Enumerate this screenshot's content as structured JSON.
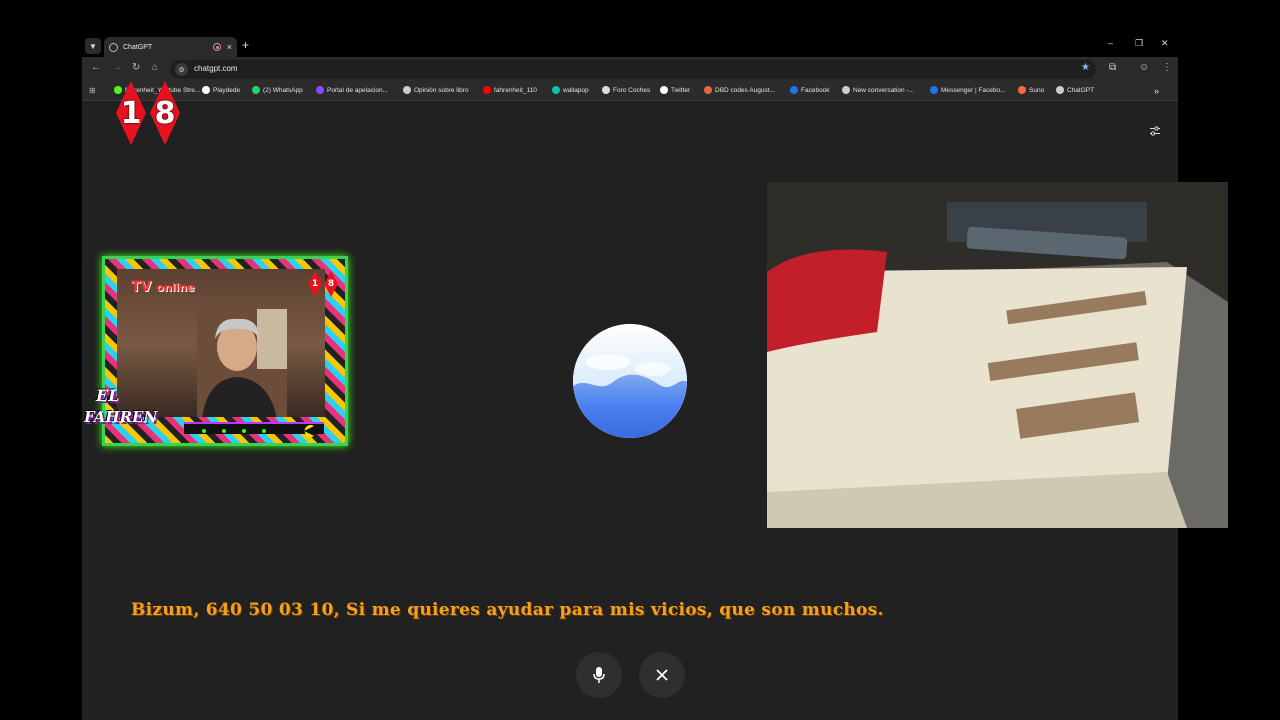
{
  "browser": {
    "tab": {
      "title": "ChatGPT",
      "close_label": "×"
    },
    "new_tab_label": "+",
    "window_controls": {
      "minimize": "–",
      "restore": "❐",
      "close": "✕"
    },
    "url": "chatgpt.com",
    "bookmarks": [
      {
        "label": "fahrenheit_Youtube Stre...",
        "icon": "kick-icon",
        "color": "#53fc18"
      },
      {
        "label": "Playdede",
        "icon": "playdede-icon",
        "color": "#ffffff"
      },
      {
        "label": "(2) WhatsApp",
        "icon": "whatsapp-icon",
        "color": "#25d366"
      },
      {
        "label": "Portal de apelacion...",
        "icon": "twitch-icon",
        "color": "#9146ff"
      },
      {
        "label": "Opinión sobre libro",
        "icon": "openai-icon",
        "color": "#cccccc"
      },
      {
        "label": "fahrenheit_110",
        "icon": "youtube-icon",
        "color": "#ff0000"
      },
      {
        "label": "wallapop",
        "icon": "wallapop-icon",
        "color": "#13c1ac"
      },
      {
        "label": "Foro Coches",
        "icon": "forocoches-icon",
        "color": "#dddddd"
      },
      {
        "label": "Twitter",
        "icon": "x-icon",
        "color": "#ffffff"
      },
      {
        "label": "DBD codes August...",
        "icon": "dbd-icon",
        "color": "#e8663d"
      },
      {
        "label": "Facebook",
        "icon": "facebook-icon",
        "color": "#1877f2"
      },
      {
        "label": "New conversation -...",
        "icon": "refresh-icon",
        "color": "#cccccc"
      },
      {
        "label": "Messenger | Facebo...",
        "icon": "facebook-icon",
        "color": "#1877f2"
      },
      {
        "label": "Suno",
        "icon": "suno-icon",
        "color": "#f26b3a"
      },
      {
        "label": "ChatGPT",
        "icon": "openai-icon",
        "color": "#cccccc"
      }
    ],
    "bookmarks_overflow": "»"
  },
  "overlay": {
    "badge_digits": [
      "1",
      "8"
    ],
    "tv_online": {
      "tv": "TV",
      "online": "online"
    },
    "logo": {
      "el": "EL",
      "fahren": "FAHREN"
    }
  },
  "ticker": "Bizum, 640 50 03 10,  Si me quieres ayudar para mis vicios, que son muchos.",
  "colors": {
    "accent_ticker": "#f2a11a",
    "orb_blue": "#4a7ff0",
    "badge_red": "#e8121f"
  }
}
